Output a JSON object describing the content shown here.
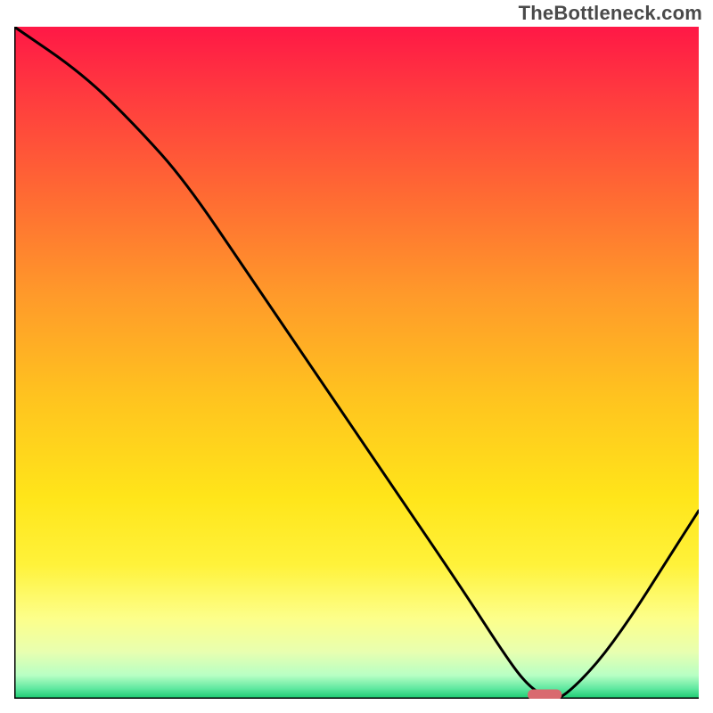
{
  "watermark": "TheBottleneck.com",
  "chart_data": {
    "type": "line",
    "title": "",
    "xlabel": "",
    "ylabel": "",
    "xlim": [
      0,
      100
    ],
    "ylim": [
      0,
      100
    ],
    "grid": false,
    "legend": false,
    "series": [
      {
        "name": "curve",
        "x": [
          0,
          10,
          18,
          25,
          35,
          45,
          55,
          65,
          72,
          75,
          78,
          80,
          85,
          90,
          95,
          100
        ],
        "y": [
          100,
          93,
          85,
          77,
          62,
          47,
          32,
          17,
          6,
          2,
          0,
          0,
          5,
          12,
          20,
          28
        ]
      }
    ],
    "marker": {
      "x_start": 75,
      "x_end": 80,
      "y": 0.6,
      "color": "#d96a6f"
    },
    "gradient_stops": [
      {
        "offset": 0.0,
        "color": "#ff1846"
      },
      {
        "offset": 0.1,
        "color": "#ff3a3f"
      },
      {
        "offset": 0.25,
        "color": "#ff6a33"
      },
      {
        "offset": 0.4,
        "color": "#ff9a2a"
      },
      {
        "offset": 0.55,
        "color": "#ffc31f"
      },
      {
        "offset": 0.7,
        "color": "#ffe51a"
      },
      {
        "offset": 0.8,
        "color": "#fff23a"
      },
      {
        "offset": 0.88,
        "color": "#fdff8a"
      },
      {
        "offset": 0.93,
        "color": "#e8ffb0"
      },
      {
        "offset": 0.965,
        "color": "#b8ffc4"
      },
      {
        "offset": 0.985,
        "color": "#5fe8a0"
      },
      {
        "offset": 1.0,
        "color": "#18c96f"
      }
    ],
    "axis_color": "#000000",
    "curve_color": "#000000"
  }
}
